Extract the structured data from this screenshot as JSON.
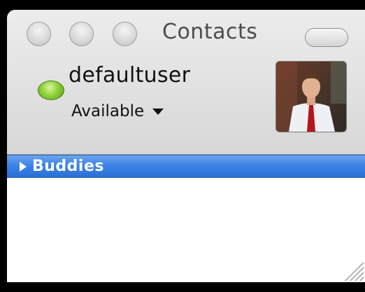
{
  "window": {
    "title": "Contacts",
    "controls": [
      "close-button",
      "minimize-button",
      "zoom-button"
    ]
  },
  "account": {
    "username": "defaultuser",
    "status": "Available",
    "status_color": "#8fd23a"
  },
  "contact_list": {
    "groups": [
      {
        "label": "Buddies",
        "expanded": false
      }
    ],
    "accent_color": "#3d84e6"
  },
  "icons": [
    "status-available-icon",
    "dropdown-caret-icon",
    "disclosure-triangle-icon",
    "resize-grip-icon"
  ]
}
